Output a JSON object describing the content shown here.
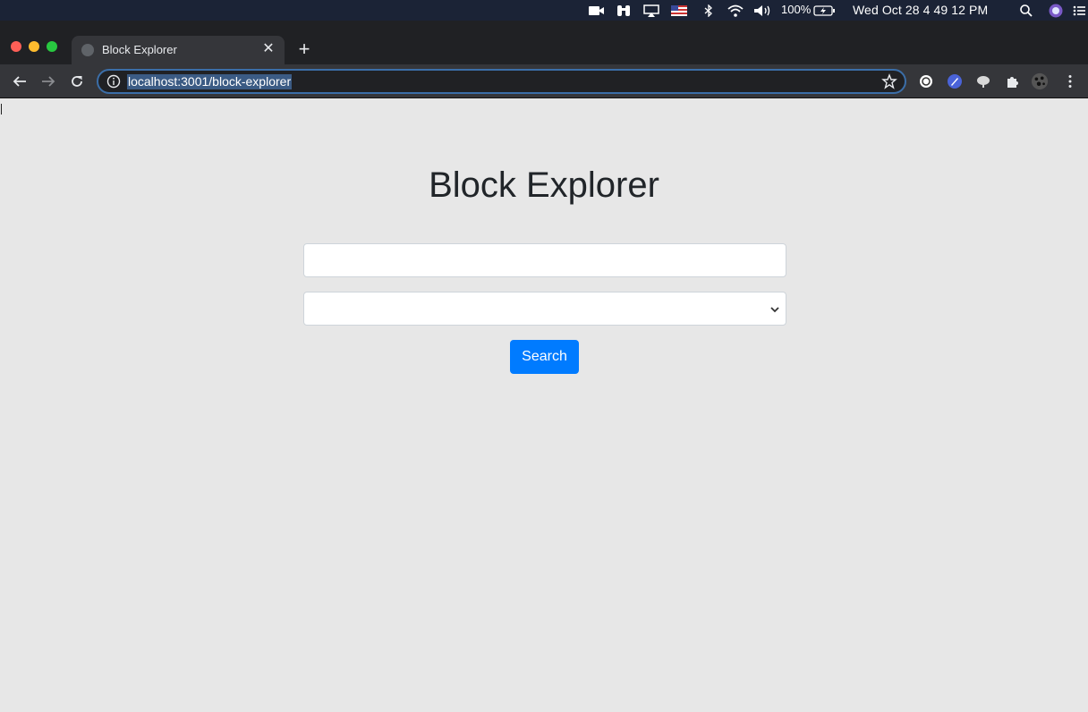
{
  "menubar": {
    "battery": "100%",
    "clock": "Wed Oct 28  4 49 12 PM",
    "icons": [
      "facetime-icon",
      "binoculars-icon",
      "airplay-icon",
      "us-flag-icon",
      "bluetooth-icon",
      "wifi-icon",
      "volume-icon",
      "battery-icon",
      "spotlight-icon",
      "siri-icon",
      "control-center-icon"
    ]
  },
  "browser": {
    "tab_title": "Block Explorer",
    "tab_close": "✕",
    "new_tab": "+",
    "url": "localhost:3001/block-explorer",
    "extensions": [
      "extension-1-icon",
      "rocket-extension-icon",
      "cloud-extension-icon",
      "puzzle-extensions-icon",
      "profile-avatar-icon",
      "menu-dots-icon"
    ]
  },
  "page": {
    "heading": "Block Explorer",
    "search_input_value": "",
    "select_value": "",
    "search_button": "Search"
  },
  "colors": {
    "primary": "#007bff",
    "page_bg": "#e7e7e7",
    "menubar_bg": "#1b2336"
  }
}
